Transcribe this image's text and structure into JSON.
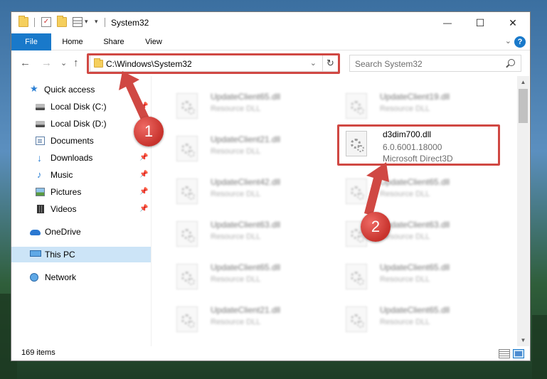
{
  "window": {
    "title": "System32",
    "minimize_glyph": "—",
    "maximize_glyph": "☐",
    "close_glyph": "✕",
    "qat_check_glyph": "✓",
    "qat_dropdown_glyph": "▾",
    "qat_customize_glyph": "▾"
  },
  "ribbon": {
    "tabs": [
      {
        "label": "File"
      },
      {
        "label": "Home"
      },
      {
        "label": "Share"
      },
      {
        "label": "View"
      }
    ],
    "collapse_glyph": "⌄",
    "help_glyph": "?"
  },
  "nav": {
    "back_glyph": "←",
    "forward_glyph": "→",
    "recent_glyph": "⌄",
    "up_glyph": "↑",
    "address_path": "C:\\Windows\\System32",
    "address_chevron_glyph": "⌄",
    "refresh_glyph": "↻",
    "search_placeholder": "Search System32"
  },
  "sidebar": {
    "pin_glyph": "📌",
    "star_glyph": "★",
    "download_glyph": "↓",
    "music_glyph": "♪",
    "items": [
      {
        "label": "Quick access",
        "icon": "star-icon"
      },
      {
        "label": "Local Disk (C:)",
        "icon": "disk-icon",
        "pinned": true
      },
      {
        "label": "Local Disk (D:)",
        "icon": "disk-icon",
        "pinned": true
      },
      {
        "label": "Documents",
        "icon": "documents-icon",
        "pinned": true
      },
      {
        "label": "Downloads",
        "icon": "downloads-icon",
        "pinned": true
      },
      {
        "label": "Music",
        "icon": "music-icon",
        "pinned": true
      },
      {
        "label": "Pictures",
        "icon": "pictures-icon",
        "pinned": true
      },
      {
        "label": "Videos",
        "icon": "videos-icon",
        "pinned": true
      },
      {
        "label": "OneDrive",
        "icon": "onedrive-icon"
      },
      {
        "label": "This PC",
        "icon": "pc-icon",
        "selected": true
      },
      {
        "label": "Network",
        "icon": "network-icon"
      }
    ]
  },
  "files": {
    "left_column": [
      {
        "name": "UpdateClient65.dll",
        "type": "Resource DLL"
      },
      {
        "name": "UpdateClient21.dll",
        "type": "Resource DLL"
      },
      {
        "name": "UpdateClient42.dll",
        "type": "Resource DLL"
      },
      {
        "name": "UpdateClient63.dll",
        "type": "Resource DLL"
      },
      {
        "name": "UpdateClient65.dll",
        "type": "Resource DLL"
      },
      {
        "name": "UpdateClient21.dll",
        "type": "Resource DLL"
      }
    ],
    "right_column": [
      {
        "name": "UpdateClient19.dll",
        "type": "Resource DLL"
      },
      {
        "name": "UpdateClient65.dll",
        "type": "Resource DLL"
      },
      {
        "name": "UpdateClient63.dll",
        "type": "Resource DLL"
      },
      {
        "name": "UpdateClient65.dll",
        "type": "Resource DLL"
      },
      {
        "name": "UpdateClient65.dll",
        "type": "Resource DLL"
      }
    ],
    "focused": {
      "name": "d3dim700.dll",
      "version": "6.0.6001.18000",
      "description": "Microsoft Direct3D"
    }
  },
  "scrollbar": {
    "up_glyph": "▲",
    "down_glyph": "▼"
  },
  "status": {
    "item_count": "169 items"
  },
  "annotations": {
    "marker_1": "1",
    "marker_2": "2",
    "color": "#d04843"
  }
}
